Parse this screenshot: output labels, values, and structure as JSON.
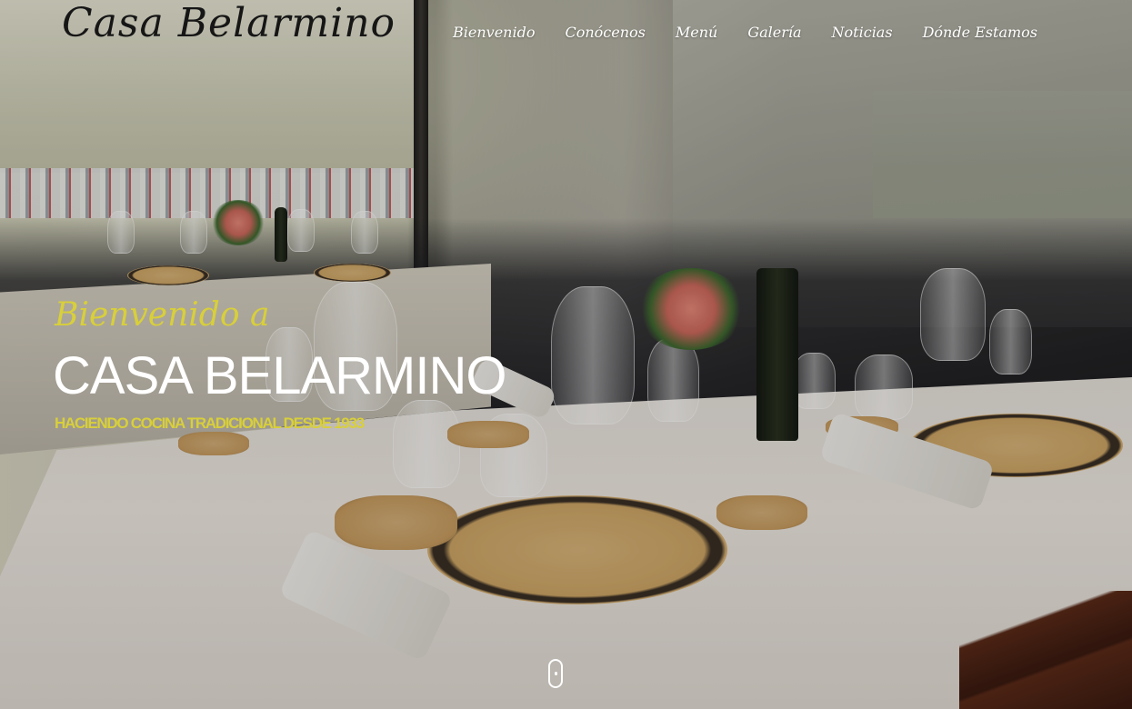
{
  "header": {
    "brand": "Casa Belarmino",
    "nav": [
      "Bienvenido",
      "Conócenos",
      "Menú",
      "Galería",
      "Noticias",
      "Dónde Estamos"
    ]
  },
  "hero": {
    "welcome": "Bienvenido a",
    "title": "CASA BELARMINO",
    "subtitle": "HACIENDO COCINA TRADICIONAL DESDE 1933",
    "background_image": "restaurant-table-setting-photo",
    "scroll_icon": "mouse-scroll-icon"
  },
  "colors": {
    "accent": "#d8cf3a",
    "nav_text": "#ffffff",
    "brand_text": "#161616",
    "title_text": "#ffffff"
  }
}
